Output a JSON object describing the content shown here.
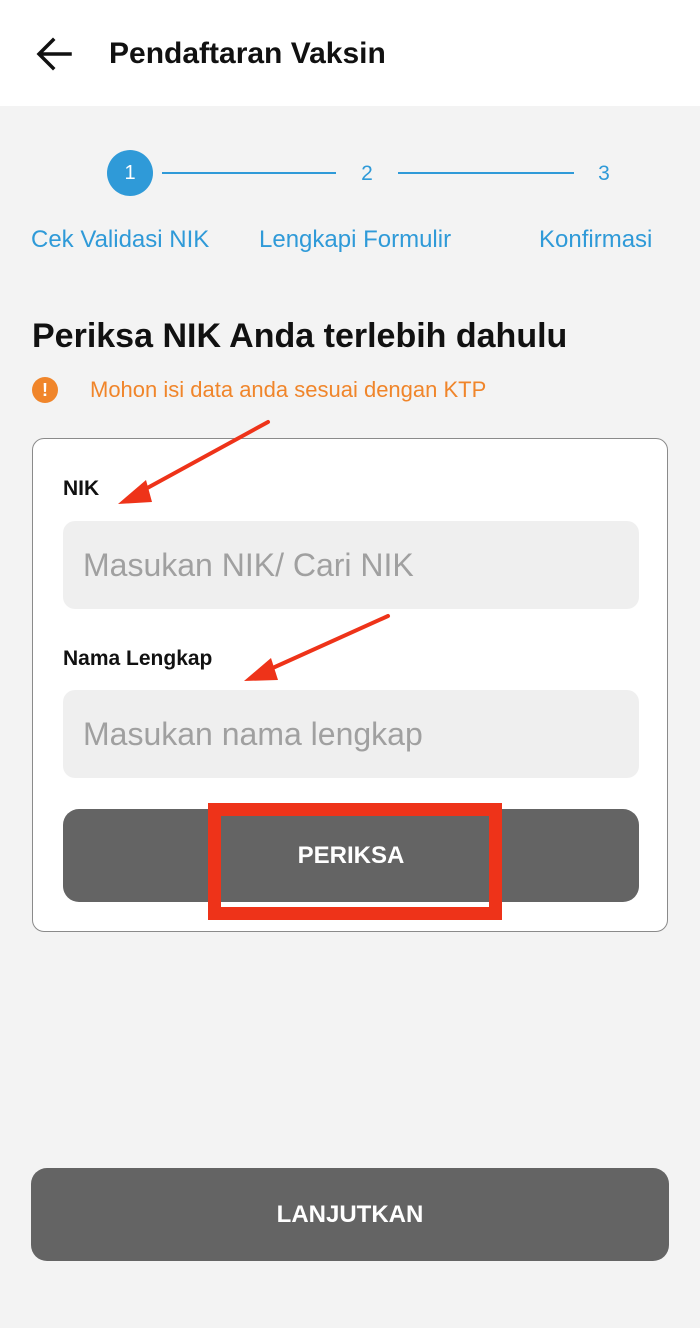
{
  "header": {
    "title": "Pendaftaran Vaksin",
    "back_icon": "arrow-left-icon"
  },
  "stepper": {
    "steps": [
      {
        "number": "1",
        "label": "Cek Validasi NIK",
        "active": true
      },
      {
        "number": "2",
        "label": "Lengkapi Formulir",
        "active": false
      },
      {
        "number": "3",
        "label": "Konfirmasi",
        "active": false
      }
    ]
  },
  "main": {
    "heading": "Periksa NIK Anda terlebih dahulu",
    "info_icon": "info-icon",
    "info_text": "Mohon isi data anda sesuai dengan KTP"
  },
  "form": {
    "nik_label": "NIK",
    "nik_placeholder": "Masukan NIK/ Cari NIK",
    "nik_value": "",
    "name_label": "Nama Lengkap",
    "name_placeholder": "Masukan nama lengkap",
    "name_value": "",
    "check_button": "PERIKSA"
  },
  "footer": {
    "continue_button": "LANJUTKAN"
  },
  "colors": {
    "accent_blue": "#2f9ad8",
    "info_orange": "#f0852a",
    "button_gray": "#646464",
    "annotation_red": "#ee3319"
  }
}
